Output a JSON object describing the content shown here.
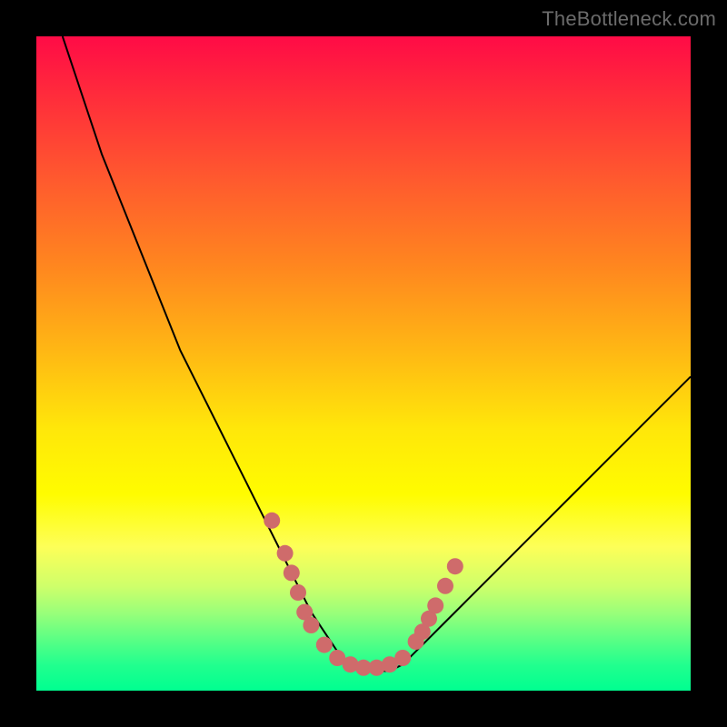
{
  "watermark": "TheBottleneck.com",
  "chart_data": {
    "type": "line",
    "title": "",
    "xlabel": "",
    "ylabel": "",
    "xlim": [
      0,
      100
    ],
    "ylim": [
      0,
      100
    ],
    "series": [
      {
        "name": "bottleneck-curve",
        "x": [
          4,
          6,
          8,
          10,
          12,
          14,
          16,
          18,
          20,
          22,
          24,
          26,
          28,
          30,
          32,
          34,
          36,
          38,
          40,
          42,
          44,
          46,
          48,
          50,
          52,
          54,
          56,
          58,
          60,
          62,
          66,
          70,
          74,
          78,
          82,
          86,
          90,
          94,
          98,
          100
        ],
        "y": [
          100,
          94,
          88,
          82,
          77,
          72,
          67,
          62,
          57,
          52,
          48,
          44,
          40,
          36,
          32,
          28,
          24,
          20,
          16,
          12,
          9,
          6,
          4,
          3,
          3,
          3,
          4,
          6,
          8,
          10,
          14,
          18,
          22,
          26,
          30,
          34,
          38,
          42,
          46,
          48
        ]
      }
    ],
    "markers": {
      "name": "highlight-markers",
      "color": "#cf6b6b",
      "points": [
        {
          "x": 36,
          "y": 26
        },
        {
          "x": 38,
          "y": 21
        },
        {
          "x": 39,
          "y": 18
        },
        {
          "x": 40,
          "y": 15
        },
        {
          "x": 41,
          "y": 12
        },
        {
          "x": 42,
          "y": 10
        },
        {
          "x": 44,
          "y": 7
        },
        {
          "x": 46,
          "y": 5
        },
        {
          "x": 48,
          "y": 4
        },
        {
          "x": 50,
          "y": 3.5
        },
        {
          "x": 52,
          "y": 3.5
        },
        {
          "x": 54,
          "y": 4
        },
        {
          "x": 56,
          "y": 5
        },
        {
          "x": 58,
          "y": 7.5
        },
        {
          "x": 59,
          "y": 9
        },
        {
          "x": 60,
          "y": 11
        },
        {
          "x": 61,
          "y": 13
        },
        {
          "x": 62.5,
          "y": 16
        },
        {
          "x": 64,
          "y": 19
        }
      ]
    }
  }
}
